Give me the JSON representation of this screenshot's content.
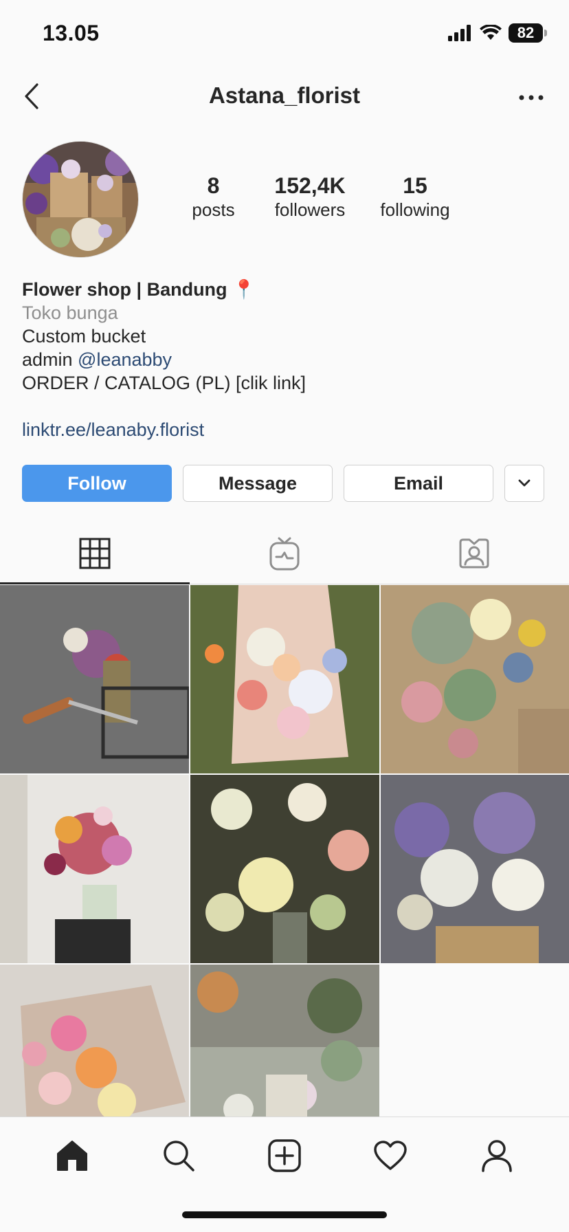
{
  "status_bar": {
    "time": "13.05",
    "battery": "82"
  },
  "nav": {
    "title": "Astana_florist"
  },
  "profile": {
    "stats": [
      {
        "value": "8",
        "label": "posts"
      },
      {
        "value": "152,4K",
        "label": "followers"
      },
      {
        "value": "15",
        "label": "following"
      }
    ],
    "bio": {
      "name": "Flower shop | Bandung 📍",
      "category": "Toko bunga",
      "line1": "Custom bucket",
      "admin_prefix": "admin ",
      "admin_mention": "@leanabby",
      "line3": "ORDER / CATALOG (PL) [clik link]",
      "link": "linktr.ee/leanaby.florist"
    }
  },
  "actions": {
    "follow": "Follow",
    "message": "Message",
    "email": "Email"
  },
  "tabs": [
    "grid-icon",
    "igtv-icon",
    "tagged-icon"
  ],
  "grid_posts": 8,
  "colors": {
    "accent": "#4b97ec",
    "link": "#2c4a73",
    "muted": "#8e8e8e"
  }
}
